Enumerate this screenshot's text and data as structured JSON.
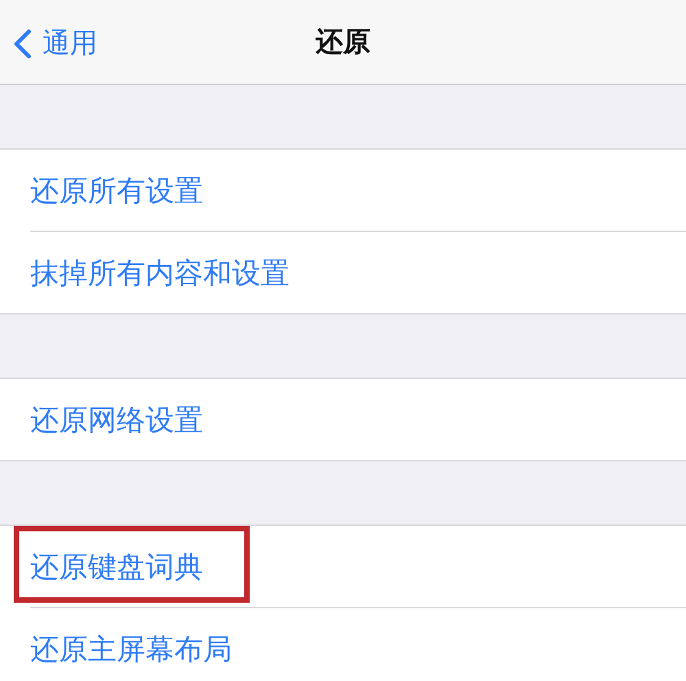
{
  "nav": {
    "back": "通用",
    "title": "还原"
  },
  "groups": [
    {
      "items": [
        {
          "label": "还原所有设置",
          "highlighted": false
        },
        {
          "label": "抹掉所有内容和设置",
          "highlighted": false
        }
      ]
    },
    {
      "items": [
        {
          "label": "还原网络设置",
          "highlighted": false
        }
      ]
    },
    {
      "items": [
        {
          "label": "还原键盘词典",
          "highlighted": true
        },
        {
          "label": "还原主屏幕布局",
          "highlighted": false
        }
      ]
    }
  ]
}
